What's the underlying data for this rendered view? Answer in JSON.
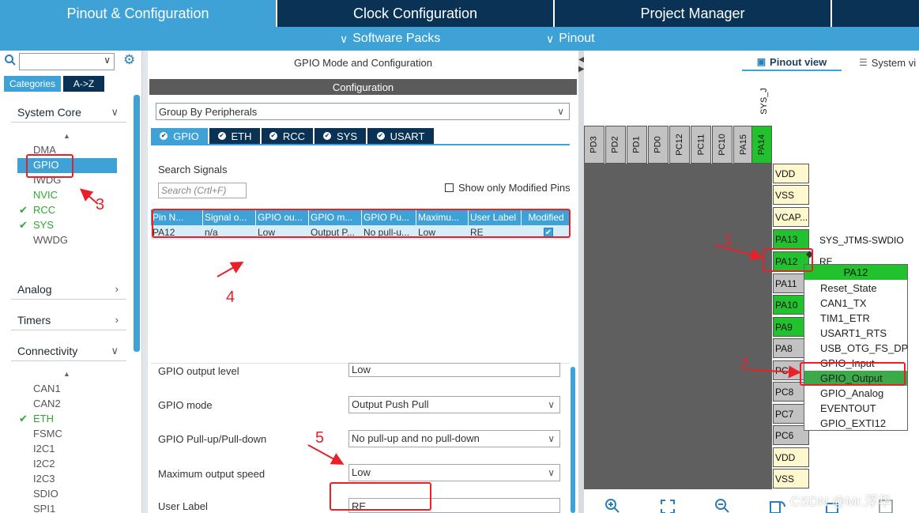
{
  "top_tabs": [
    "Pinout & Configuration",
    "Clock Configuration",
    "Project Manager"
  ],
  "sub_menu": [
    "Software Packs",
    "Pinout"
  ],
  "left": {
    "categories_btn": "Categories",
    "az_btn": "A->Z",
    "system_core": "System Core",
    "system_core_items": [
      "DMA",
      "GPIO",
      "IWDG",
      "NVIC",
      "RCC",
      "SYS",
      "WWDG"
    ],
    "analog": "Analog",
    "timers": "Timers",
    "connectivity": "Connectivity",
    "connectivity_items": [
      "CAN1",
      "CAN2",
      "ETH",
      "FSMC",
      "I2C1",
      "I2C2",
      "I2C3",
      "SDIO",
      "SPI1"
    ]
  },
  "middle": {
    "header": "GPIO Mode and Configuration",
    "config_bar": "Configuration",
    "group_by": "Group By Peripherals",
    "tabs": [
      "GPIO",
      "ETH",
      "RCC",
      "SYS",
      "USART"
    ],
    "search_label": "Search Signals",
    "search_placeholder": "Search (Crtl+F)",
    "show_modified": "Show only Modified Pins",
    "table_headers": [
      "Pin N...",
      "Signal o...",
      "GPIO ou...",
      "GPIO m...",
      "GPIO Pu...",
      "Maximu...",
      "User Label",
      "Modified"
    ],
    "table_row": [
      "PA12",
      "n/a",
      "Low",
      "Output P...",
      "No pull-u...",
      "Low",
      "RE"
    ],
    "props": [
      {
        "label": "GPIO output level",
        "value": "Low"
      },
      {
        "label": "GPIO mode",
        "value": "Output Push Pull"
      },
      {
        "label": "GPIO Pull-up/Pull-down",
        "value": "No pull-up and no pull-down"
      },
      {
        "label": "Maximum output speed",
        "value": "Low"
      },
      {
        "label": "User Label",
        "value": "RE"
      }
    ]
  },
  "right": {
    "pinout_view": "Pinout view",
    "system_view": "System vi",
    "sys_label": "SYS_J",
    "top_pins": [
      "PD3",
      "PD2",
      "PD1",
      "PD0",
      "PC12",
      "PC11",
      "PC10",
      "PA15",
      "PA14"
    ],
    "side_pins": [
      "VDD",
      "VSS",
      "VCAP...",
      "PA13",
      "PA12",
      "PA11",
      "PA10",
      "PA9",
      "PA8",
      "PC9",
      "PC8",
      "PC7",
      "PC6",
      "VDD",
      "VSS"
    ],
    "pa13_signal": "SYS_JTMS-SWDIO",
    "pa12_signal": "RE",
    "menu_title": "PA12",
    "menu_items": [
      "Reset_State",
      "CAN1_TX",
      "TIM1_ETR",
      "USART1_RTS",
      "USB_OTG_FS_DP",
      "GPIO_Input",
      "GPIO_Output",
      "GPIO_Analog",
      "EVENTOUT",
      "GPIO_EXTI12"
    ]
  },
  "annotations": [
    "1",
    "2",
    "3",
    "4",
    "5"
  ],
  "watermark": "CSDN @Mr.浮华",
  "colors": {
    "tab_dark": "#0a3255",
    "tab_blue": "#3ea2d7",
    "pin_green": "#22c22e",
    "pin_yellow": "#fff8cf",
    "annotation_red": "#e8202a"
  }
}
